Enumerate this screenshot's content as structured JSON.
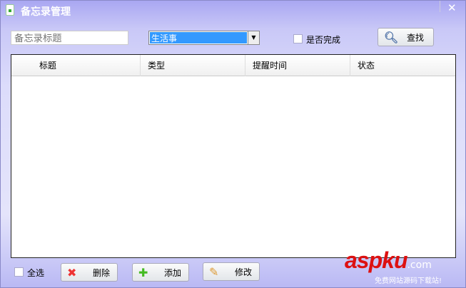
{
  "window": {
    "title": "备忘录管理",
    "close": "✕"
  },
  "filters": {
    "title_placeholder": "备忘录标题",
    "type_value": "生活事",
    "done_label": "是否完成",
    "search_label": "查找"
  },
  "table": {
    "columns": [
      "",
      "标题",
      "类型",
      "提醒时间",
      "状态"
    ]
  },
  "footer": {
    "select_all": "全选",
    "delete": "删除",
    "add": "添加",
    "edit": "修改"
  },
  "watermark": {
    "brand": "aspku",
    ".com": ".com",
    "slogan": "免费网站源码下载站!"
  }
}
